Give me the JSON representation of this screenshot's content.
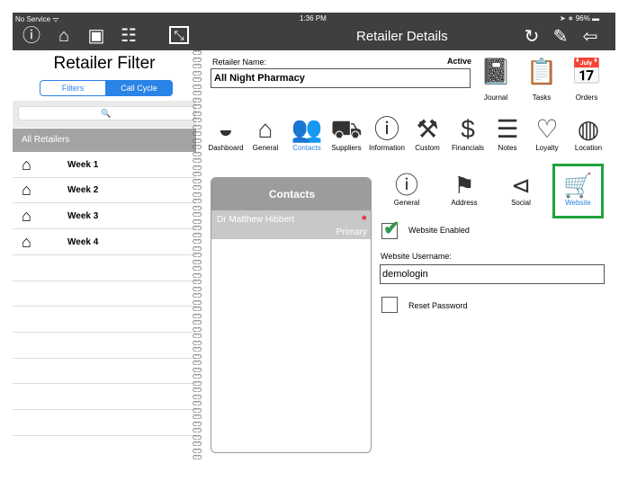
{
  "status": {
    "carrier": "No Service",
    "time": "1:36 PM",
    "battery": "96%"
  },
  "header": {
    "title": "Retailer Details",
    "left_icons": [
      "info-icon",
      "store-icon",
      "storefront-icon",
      "signboard-icon",
      "expand-icon"
    ],
    "right_icons": [
      "refresh-device-icon",
      "pencil-icon",
      "back-arrow-icon"
    ]
  },
  "filter": {
    "title": "Retailer Filter",
    "segments": [
      "Filters",
      "Call Cycle"
    ],
    "search_placeholder": "🔍",
    "all_label": "All Retailers",
    "weeks": [
      "Week 1",
      "Week 2",
      "Week 3",
      "Week 4"
    ]
  },
  "retailer": {
    "name_label": "Retailer Name:",
    "status": "Active",
    "name": "All Night Pharmacy",
    "quick_actions": [
      {
        "label": "Journal",
        "icon": "journal-icon"
      },
      {
        "label": "Tasks",
        "icon": "tasks-icon"
      },
      {
        "label": "Orders",
        "icon": "orders-icon"
      }
    ],
    "tiles": [
      {
        "label": "Dashboard",
        "icon": "gauge-icon"
      },
      {
        "label": "General",
        "icon": "store-icon"
      },
      {
        "label": "Contacts",
        "icon": "contacts-icon",
        "active": true
      },
      {
        "label": "Suppliers",
        "icon": "truck-icon"
      },
      {
        "label": "Information",
        "icon": "info-icon"
      },
      {
        "label": "Custom",
        "icon": "wrench-icon"
      },
      {
        "label": "Financials",
        "icon": "dollar-icon"
      },
      {
        "label": "Notes",
        "icon": "notes-icon"
      },
      {
        "label": "Loyalty",
        "icon": "heart-icon"
      },
      {
        "label": "Location",
        "icon": "globe-icon"
      }
    ]
  },
  "contacts": {
    "title": "Contacts",
    "items": [
      {
        "name": "Dr  Matthew Hibbert",
        "role": "Primary",
        "required": "*"
      }
    ]
  },
  "detail": {
    "tabs": [
      {
        "label": "General",
        "icon": "info-icon"
      },
      {
        "label": "Address",
        "icon": "signpost-icon"
      },
      {
        "label": "Social",
        "icon": "share-icon"
      },
      {
        "label": "Website",
        "icon": "cart-icon",
        "active": true
      }
    ],
    "website_enabled_label": "Website Enabled",
    "website_enabled": true,
    "username_label": "Website Username:",
    "username": "demologin",
    "reset_label": "Reset Password",
    "reset_checked": false
  },
  "colors": {
    "accent": "#2a83e6",
    "highlight_border": "#1fa33a",
    "bar": "#3f3f3f"
  }
}
